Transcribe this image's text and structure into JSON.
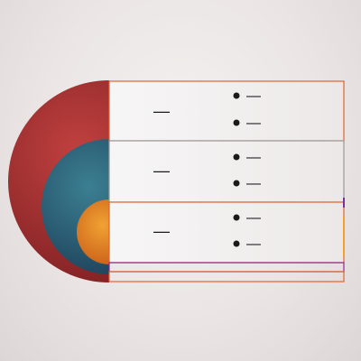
{
  "diagram": {
    "layers": [
      {
        "id": "outer",
        "circle_color_light": "#c0413f",
        "circle_color_dark": "#7d1f22",
        "frame_color": "#e0632f",
        "label": "—",
        "bullets": [
          "—",
          "—"
        ]
      },
      {
        "id": "middle",
        "circle_color_light": "#3c7f92",
        "circle_color_dark": "#1c3f58",
        "frame_color": "#9a9a9a",
        "label": "—",
        "bullets": [
          "—",
          "—"
        ]
      },
      {
        "id": "inner",
        "circle_color_light": "#f0a233",
        "circle_color_dark": "#c85a17",
        "frame_color": "#e0632f",
        "label": "—",
        "bullets": [
          "—",
          "—"
        ]
      }
    ],
    "divider_colors": [
      "#8b2a8b",
      "#e0632f"
    ],
    "accent_colors": {
      "purple": "#7b2f9a",
      "orange": "#f2a12f"
    }
  }
}
